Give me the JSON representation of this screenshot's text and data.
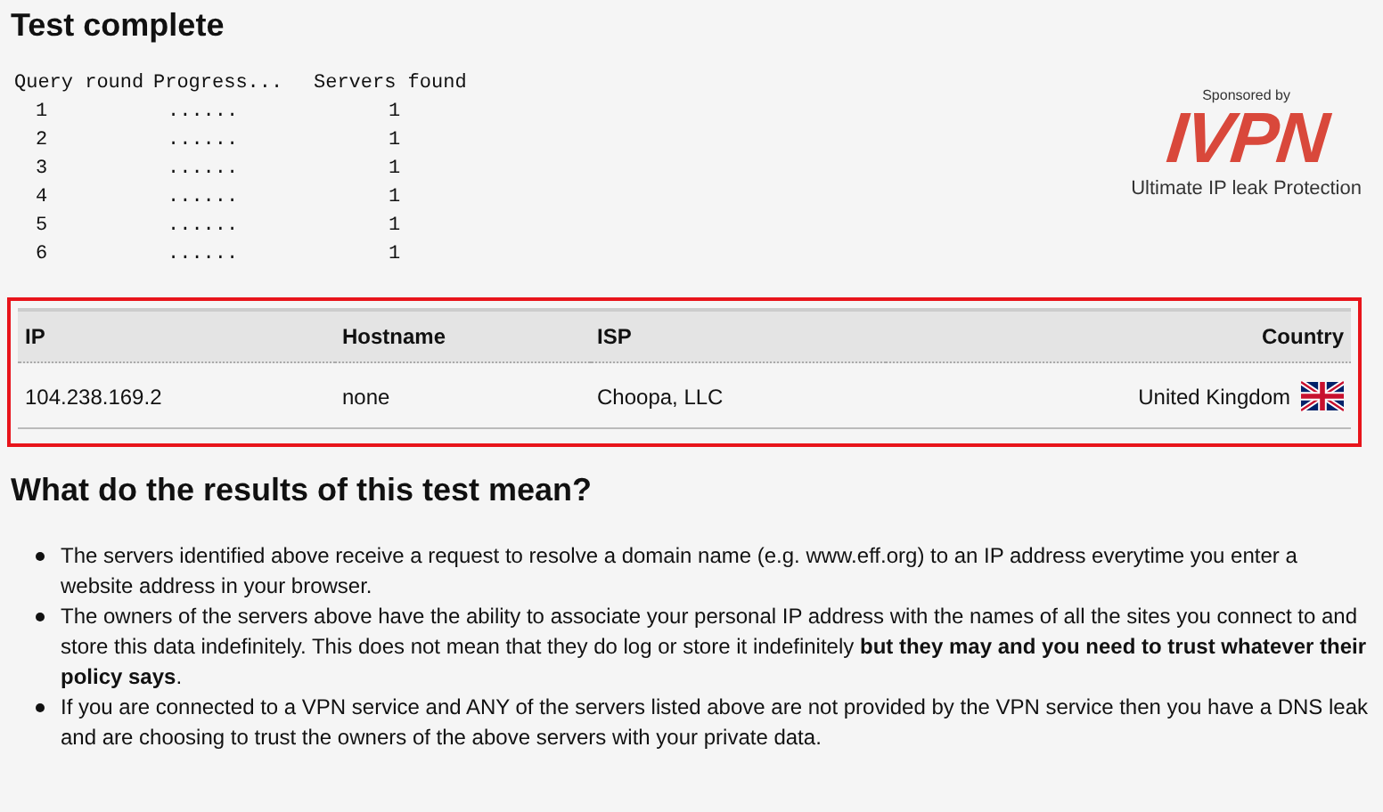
{
  "title": "Test complete",
  "query": {
    "columns": [
      "Query round",
      "Progress...",
      "Servers found"
    ],
    "rows": [
      {
        "round": "1",
        "progress": "......",
        "servers": "1"
      },
      {
        "round": "2",
        "progress": "......",
        "servers": "1"
      },
      {
        "round": "3",
        "progress": "......",
        "servers": "1"
      },
      {
        "round": "4",
        "progress": "......",
        "servers": "1"
      },
      {
        "round": "5",
        "progress": "......",
        "servers": "1"
      },
      {
        "round": "6",
        "progress": "......",
        "servers": "1"
      }
    ]
  },
  "sponsor": {
    "label": "Sponsored by",
    "logo": "IVPN",
    "tagline": "Ultimate IP leak Protection"
  },
  "results": {
    "columns": [
      "IP",
      "Hostname",
      "ISP",
      "Country"
    ],
    "rows": [
      {
        "ip": "104.238.169.2",
        "hostname": "none",
        "isp": "Choopa, LLC",
        "country": "United Kingdom"
      }
    ]
  },
  "explanation": {
    "heading": "What do the results of this test mean?",
    "items": [
      "The servers identified above receive a request to resolve a domain name (e.g. www.eff.org) to an IP address everytime you enter a website address in your browser.",
      "The owners of the servers above have the ability to associate your personal IP address with the names of all the sites you connect to and store this data indefinitely. This does not mean that they do log or store it indefinitely **but they may and you need to trust whatever their policy says**.",
      "If you are connected to a VPN service and ANY of the servers listed above are not provided by the VPN service then you have a DNS leak and are choosing to trust the owners of the above servers with your private data."
    ]
  }
}
